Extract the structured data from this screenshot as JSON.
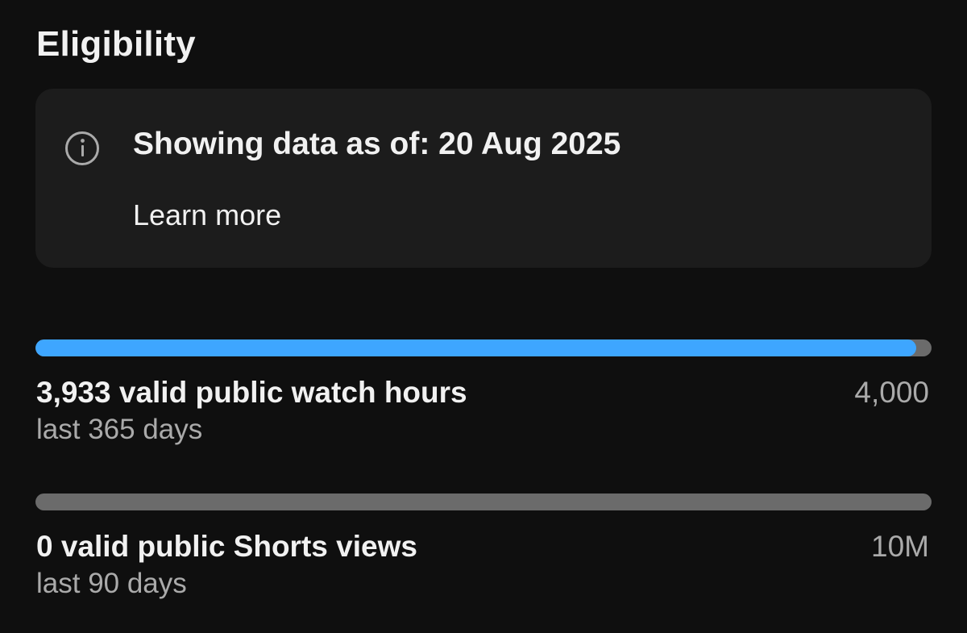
{
  "header": {
    "title": "Eligibility"
  },
  "info_card": {
    "icon": "info-icon",
    "text": "Showing data as of: 20 Aug 2025",
    "link": "Learn more"
  },
  "metrics": [
    {
      "label": "3,933 valid public watch hours",
      "period": "last 365 days",
      "target": "4,000",
      "progress_fraction": 0.98325
    },
    {
      "label": "0 valid public Shorts views",
      "period": "last 90 days",
      "target": "10M",
      "progress_fraction": 0
    }
  ],
  "colors": {
    "background": "#0f0f0f",
    "card": "#1c1c1c",
    "accent": "#3ea6ff",
    "track": "#6b6b6b",
    "secondary_text": "#aaaaaa"
  }
}
